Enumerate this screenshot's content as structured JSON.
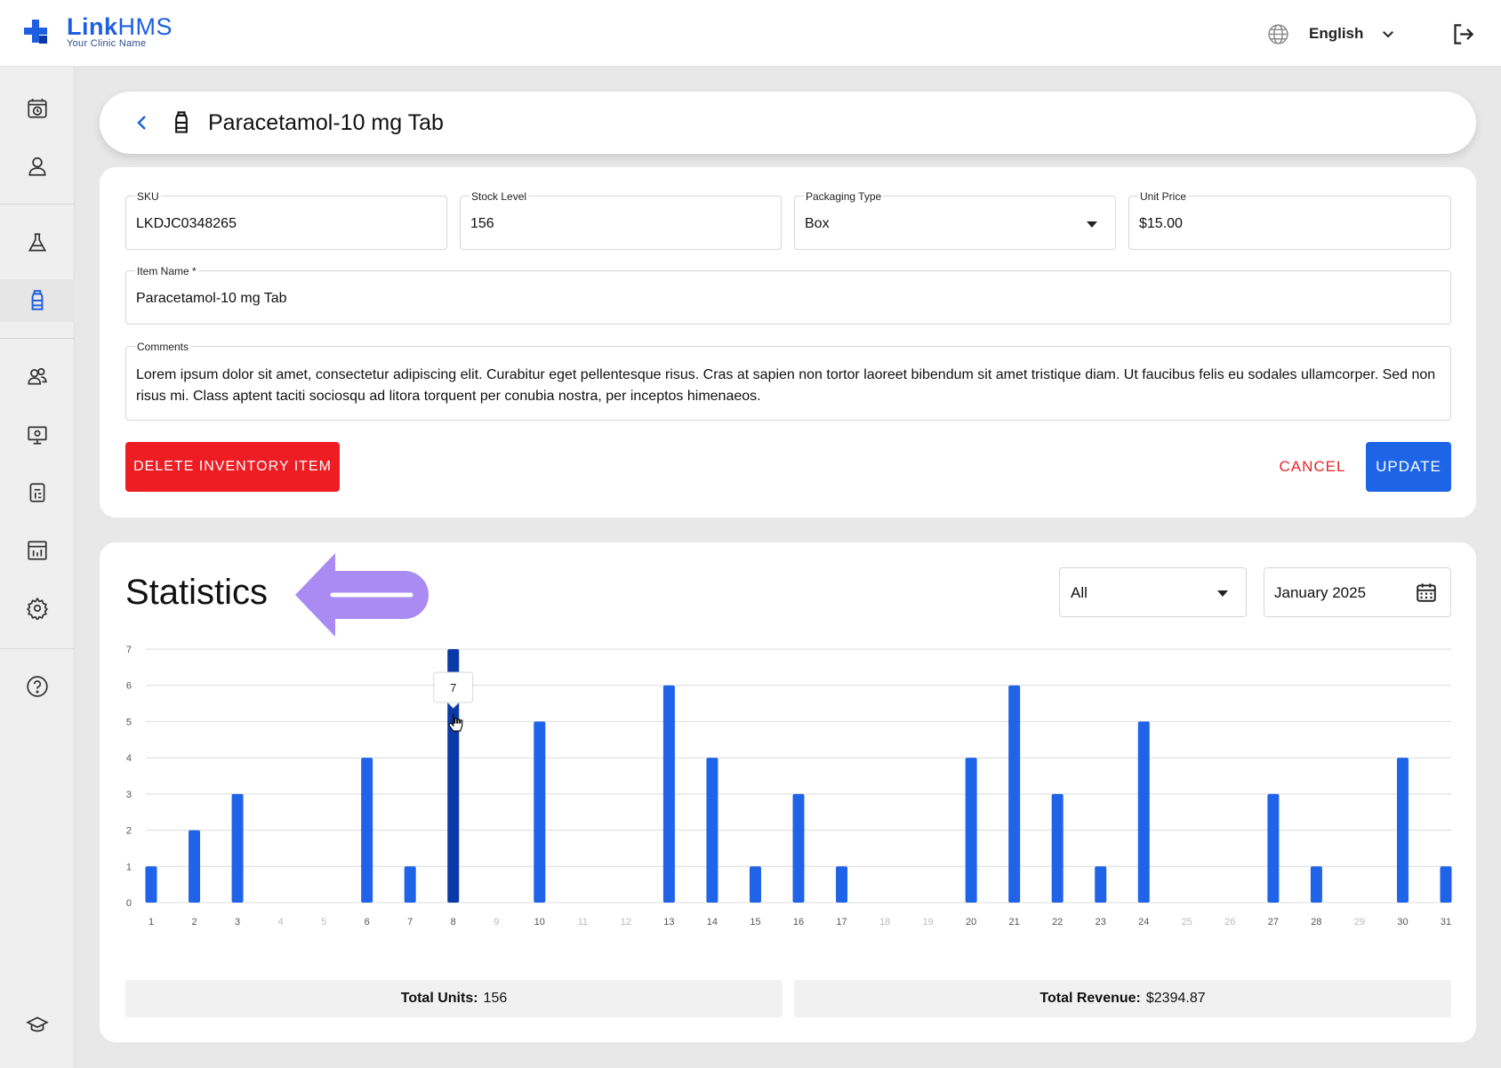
{
  "brand": {
    "name_bold": "Link",
    "name_regular": "HMS",
    "subtitle": "Your Clinic Name",
    "accent_color": "#1d5fe0"
  },
  "topbar": {
    "language": "English",
    "icons": [
      "globe-icon",
      "chevron-down-icon",
      "logout-icon"
    ]
  },
  "sidebar": {
    "items": [
      {
        "icon": "appointments-icon",
        "active": false
      },
      {
        "icon": "patient-icon",
        "active": false
      },
      {
        "icon": "lab-flask-icon",
        "active": false
      },
      {
        "icon": "pharmacy-bottle-icon",
        "active": true
      },
      {
        "icon": "staff-icon",
        "active": false
      },
      {
        "icon": "monitor-icon",
        "active": false
      },
      {
        "icon": "billing-icon",
        "active": false
      },
      {
        "icon": "reports-icon",
        "active": false
      },
      {
        "icon": "settings-icon",
        "active": false
      },
      {
        "icon": "help-icon",
        "active": false
      },
      {
        "icon": "education-icon",
        "active": false
      }
    ]
  },
  "header": {
    "title": "Paracetamol-10 mg Tab"
  },
  "form": {
    "sku": {
      "label": "SKU",
      "value": "LKDJC0348265"
    },
    "stock_level": {
      "label": "Stock Level",
      "value": "156"
    },
    "packaging_type": {
      "label": "Packaging Type",
      "value": "Box"
    },
    "unit_price": {
      "label": "Unit Price",
      "value": "$15.00"
    },
    "item_name": {
      "label": "Item Name *",
      "value": "Paracetamol-10 mg Tab"
    },
    "comments": {
      "label": "Comments",
      "value": "Lorem ipsum dolor sit amet, consectetur adipiscing elit. Curabitur eget pellentesque risus. Cras at sapien non tortor laoreet bibendum sit amet tristique diam. Ut faucibus felis eu sodales ullamcorper. Sed non risus mi. Class aptent taciti sociosqu ad litora torquent per conubia nostra, per inceptos himenaeos."
    },
    "delete_label": "DELETE INVENTORY ITEM",
    "cancel_label": "CANCEL",
    "update_label": "UPDATE",
    "colors": {
      "delete": "#ee1d24",
      "update": "#1d64e6"
    }
  },
  "statistics": {
    "title": "Statistics",
    "filter_value": "All",
    "date_value": "January 2025",
    "total_units_label": "Total Units:",
    "total_units_value": "156",
    "total_revenue_label": "Total Revenue:",
    "total_revenue_value": "$2394.87"
  },
  "chart_data": {
    "type": "bar",
    "categories": [
      "1",
      "2",
      "3",
      "4",
      "5",
      "6",
      "7",
      "8",
      "9",
      "10",
      "11",
      "12",
      "13",
      "14",
      "15",
      "16",
      "17",
      "18",
      "19",
      "20",
      "21",
      "22",
      "23",
      "24",
      "25",
      "26",
      "27",
      "28",
      "29",
      "30",
      "31"
    ],
    "values": [
      1,
      2,
      3,
      0,
      0,
      4,
      1,
      7,
      0,
      5,
      0,
      0,
      6,
      4,
      1,
      3,
      1,
      0,
      0,
      4,
      6,
      3,
      1,
      5,
      0,
      0,
      3,
      1,
      0,
      4,
      1
    ],
    "ylim": [
      0,
      7
    ],
    "yticks": [
      "0",
      "1",
      "2",
      "3",
      "4",
      "5",
      "6",
      "7"
    ],
    "grid": true,
    "highlighted_index": 7,
    "tooltip": "7",
    "bar_color": "#1f63e9",
    "highlight_color": "#0b3aa8"
  }
}
